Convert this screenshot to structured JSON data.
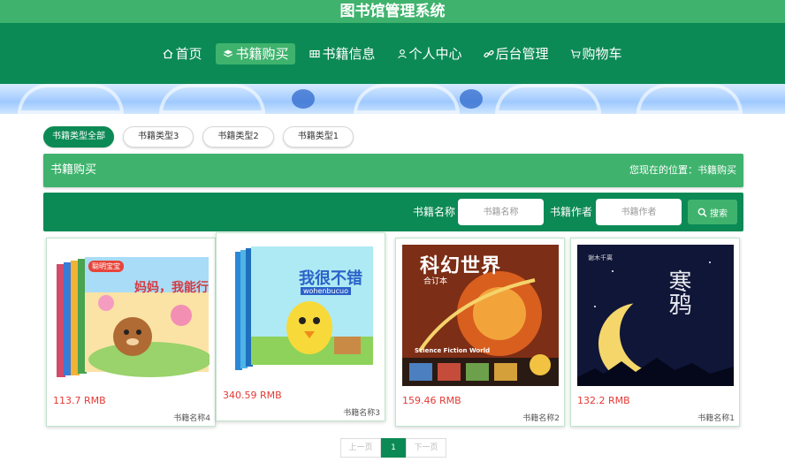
{
  "app": {
    "title": "图书馆管理系统"
  },
  "nav": [
    {
      "label": "首页",
      "icon": "home-icon"
    },
    {
      "label": "书籍购买",
      "icon": "layers-icon",
      "active": true
    },
    {
      "label": "书籍信息",
      "icon": "grid-icon"
    },
    {
      "label": "个人中心",
      "icon": "user-icon"
    },
    {
      "label": "后台管理",
      "icon": "link-icon"
    },
    {
      "label": "购物车",
      "icon": "cart-icon"
    }
  ],
  "tabs": [
    "书籍类型全部",
    "书籍类型3",
    "书籍类型2",
    "书籍类型1"
  ],
  "section": {
    "title": "书籍购买",
    "location": "您现在的位置：书籍购买"
  },
  "search": {
    "name_label": "书籍名称",
    "name_placeholder": "书籍名称",
    "author_label": "书籍作者",
    "author_placeholder": "书籍作者",
    "button": "搜索"
  },
  "books": [
    {
      "price": "113.7 RMB",
      "name": "书籍名称4",
      "cover_title": "妈妈，我能行",
      "cover_series": "聪明宝宝"
    },
    {
      "price": "340.59 RMB",
      "name": "书籍名称3",
      "cover_title": "我很不错",
      "cover_sub": "wohenbucuo"
    },
    {
      "price": "159.46 RMB",
      "name": "书籍名称2",
      "cover_title": "科幻世界",
      "cover_sub": "合订本",
      "cover_en": "Science Fiction World"
    },
    {
      "price": "132.2 RMB",
      "name": "书籍名称1",
      "cover_title": "寒鸦",
      "cover_author": "谢木千离"
    }
  ],
  "pager": {
    "prev": "上一页",
    "current": "1",
    "next": "下一页"
  },
  "colors": {
    "primary": "#0c8a55",
    "accent": "#3fb36d",
    "price": "#e53935"
  }
}
